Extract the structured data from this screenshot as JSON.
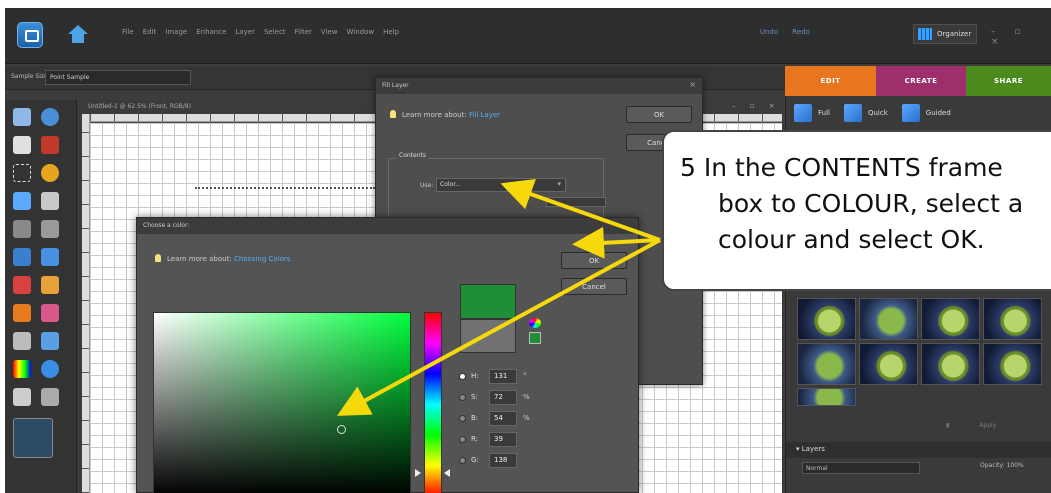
{
  "menubar": {
    "items": [
      "File",
      "Edit",
      "Image",
      "Enhance",
      "Layer",
      "Select",
      "Filter",
      "View",
      "Window",
      "Help"
    ],
    "undo": "Undo",
    "redo": "Redo",
    "organizer": "Organizer",
    "window_controls": "– ▫ ×"
  },
  "options_bar": {
    "sample_size_label": "Sample Size:",
    "sample_size_value": "Point Sample"
  },
  "mode_tabs": [
    "EDIT",
    "CREATE",
    "SHARE"
  ],
  "edit_modes": [
    "Full",
    "Quick",
    "Guided"
  ],
  "document": {
    "title": "Untitled-1 @ 62.5% (Front, RGB/8)",
    "controls": "– ▫ ×"
  },
  "fill_layer_dialog": {
    "title": "Fill Layer",
    "close": "×",
    "learn_prefix": "Learn more about:",
    "learn_link": "Fill Layer",
    "ok": "OK",
    "cancel": "Cancel",
    "contents_label": "Contents",
    "use_label": "Use:",
    "use_value": "Color..."
  },
  "color_dialog": {
    "title": "Choose a color:",
    "learn_prefix": "Learn more about:",
    "learn_link": "Choosing Colors",
    "ok": "OK",
    "cancel": "Cancel",
    "fields": [
      {
        "label": "H:",
        "value": "131",
        "unit": "°"
      },
      {
        "label": "S:",
        "value": "72",
        "unit": "%"
      },
      {
        "label": "B:",
        "value": "54",
        "unit": "%"
      },
      {
        "label": "R:",
        "value": "39",
        "unit": ""
      },
      {
        "label": "G:",
        "value": "138",
        "unit": ""
      }
    ],
    "new_color": "#1f8f37",
    "old_color": "#717171"
  },
  "layers_panel": {
    "title": "Layers",
    "blend_mode": "Normal",
    "opacity_label": "Opacity:",
    "opacity_value": "100%",
    "apply": "Apply"
  },
  "callout": {
    "line1": "5  In the CONTENTS frame",
    "line2": "box to COLOUR, select a",
    "line3": "colour and select OK."
  },
  "colors": {
    "arrow": "#f5d90a",
    "edit_tab": "#e8761e",
    "create_tab": "#9d2f6c",
    "share_tab": "#4d8a1e"
  }
}
